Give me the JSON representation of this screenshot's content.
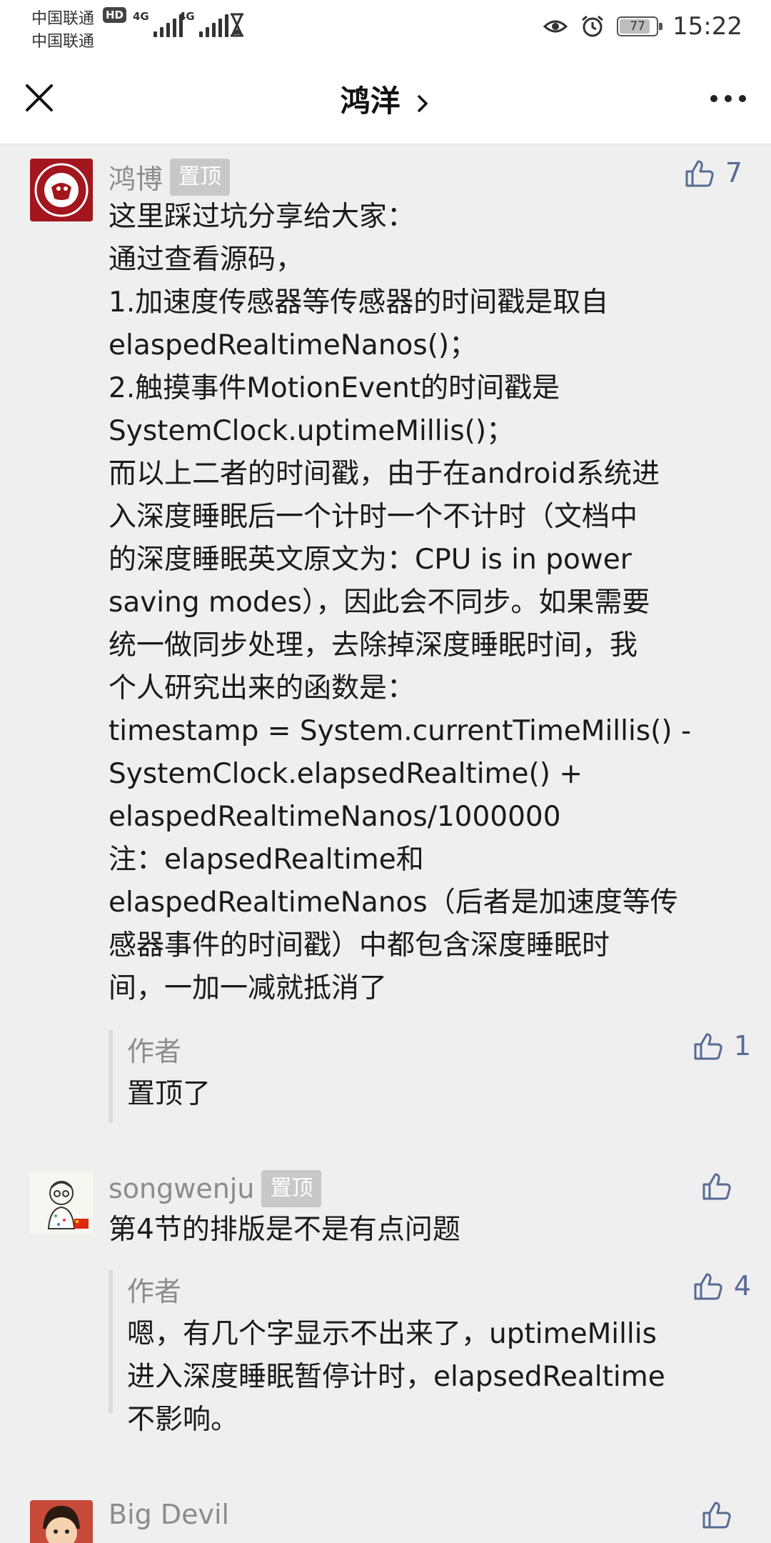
{
  "status_bar": {
    "carrier_1": "中国联通",
    "carrier_2": "中国联通",
    "hd_label": "HD",
    "network_1": "4G",
    "network_2": "4G",
    "battery_level": "77",
    "time": "15:22"
  },
  "header": {
    "title": "鸿洋"
  },
  "comments": [
    {
      "author": "鸿博",
      "pinned_label": "置顶",
      "likes": "7",
      "lines": [
        "这里踩过坑分享给大家：",
        "通过查看源码，",
        "1.加速度传感器等传感器的时间戳是取自",
        "elaspedRealtimeNanos()；",
        "2.触摸事件MotionEvent的时间戳是",
        "SystemClock.uptimeMillis()；",
        "而以上二者的时间戳，由于在android系统进",
        "入深度睡眠后一个计时一个不计时（文档中",
        "的深度睡眠英文原文为：CPU is in power",
        "saving modes），因此会不同步。如果需要",
        "统一做同步处理，去除掉深度睡眠时间，我",
        "个人研究出来的函数是：",
        "timestamp = System.currentTimeMillis() -",
        "SystemClock.elapsedRealtime() +",
        "elaspedRealtimeNanos/1000000",
        "注：elapsedRealtime和",
        "elaspedRealtimeNanos（后者是加速度等传",
        "感器事件的时间戳）中都包含深度睡眠时",
        "间，一加一减就抵消了"
      ],
      "reply": {
        "label": "作者",
        "likes": "1",
        "lines": [
          "置顶了"
        ]
      }
    },
    {
      "author": "songwenju",
      "pinned_label": "置顶",
      "likes": "",
      "lines": [
        "第4节的排版是不是有点问题"
      ],
      "reply": {
        "label": "作者",
        "likes": "4",
        "lines": [
          "嗯，有几个字显示不出来了，uptimeMillis",
          "进入深度睡眠暂停计时，elapsedRealtime",
          "不影响。"
        ]
      }
    },
    {
      "author": "Big Devil",
      "likes": ""
    }
  ],
  "colors": {
    "link_blue": "#576b95",
    "name_gray": "#8c8c8c",
    "badge_gray": "#c8c8c8",
    "background": "#efefef"
  }
}
